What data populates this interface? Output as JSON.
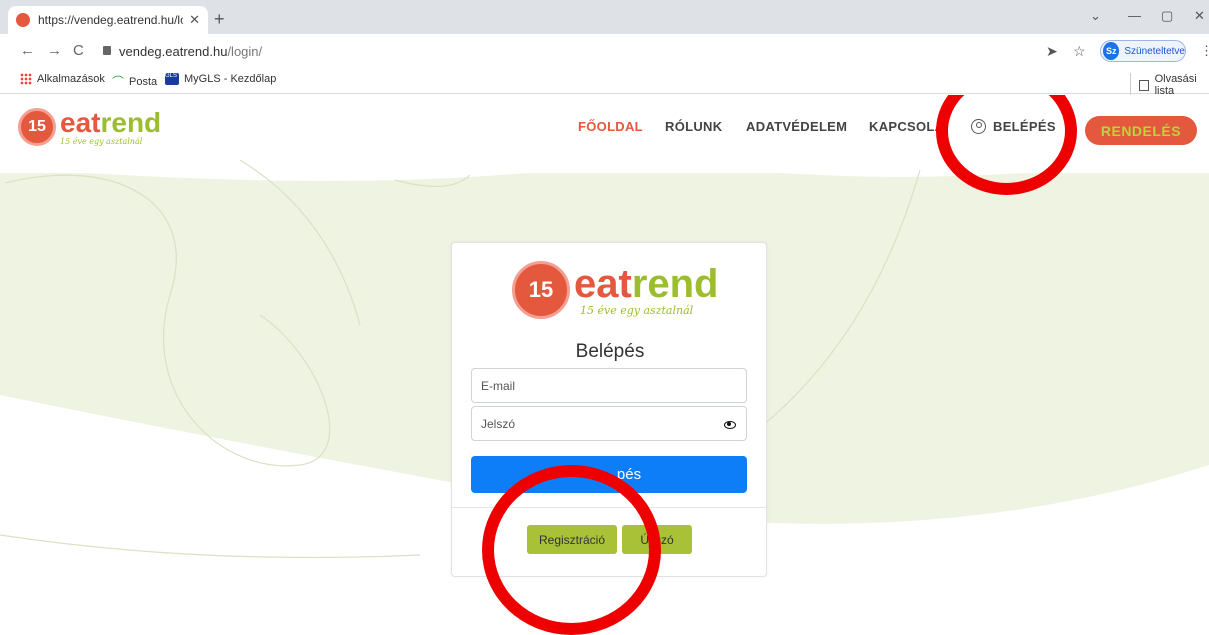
{
  "browser": {
    "tab_title": "https://vendeg.eatrend.hu/login/",
    "tab_close": "✕",
    "new_tab": "+",
    "url_host": "vendeg.eatrend.hu",
    "url_path": "/login/",
    "profile_initials": "Sz",
    "profile_label": "Szüneteltetve",
    "bookmarks": [
      {
        "label": "Alkalmazások"
      },
      {
        "label": "Posta"
      },
      {
        "label": "MyGLS - Kezdőlap"
      }
    ],
    "reading_list": "Olvasási lista"
  },
  "site": {
    "logo_number": "15",
    "logo_word_a": "eat",
    "logo_word_b": "rend",
    "logo_tagline": "15 éve egy asztalnál",
    "nav": [
      {
        "label": "FŐOLDAL"
      },
      {
        "label": "RÓLUNK"
      },
      {
        "label": "ADATVÉDELEM"
      },
      {
        "label": "KAPCSOLA"
      },
      {
        "label": "BELÉPÉS"
      }
    ],
    "order_button": "RENDELÉS"
  },
  "login": {
    "title": "Belépés",
    "email_placeholder": "E-mail",
    "password_placeholder": "Jelszó",
    "submit_label": "pés",
    "register_label": "Regisztráció",
    "new_password_label": "Új szó"
  },
  "colors": {
    "brand_red": "#e4583e",
    "brand_green": "#a8c136",
    "submit_blue": "#0d7ef8",
    "annotation_red": "#ef0000"
  }
}
